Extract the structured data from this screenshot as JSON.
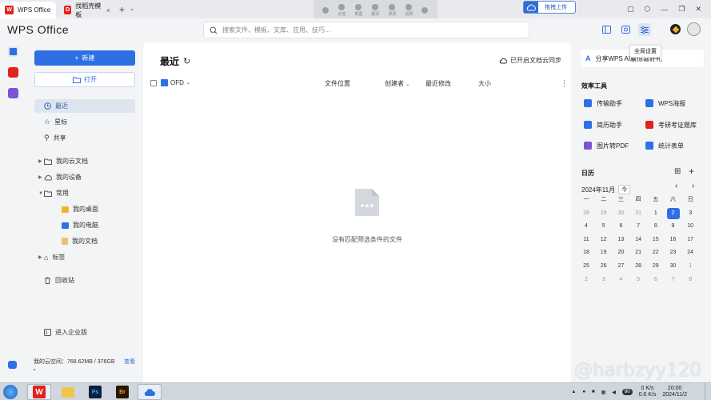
{
  "tabs": [
    {
      "label": "WPS Office",
      "icon": "wps-logo-icon",
      "color": "#e2231a",
      "active": true
    },
    {
      "label": "找稻壳模板",
      "icon": "docer-logo-icon",
      "color": "#e2231a",
      "active": false
    }
  ],
  "mini_tools": [
    "云签",
    "截图",
    "翻译",
    "录屏",
    "投屏",
    "隐私"
  ],
  "cloud_upload_label": "拖拽上传",
  "brand": "WPS Office",
  "search": {
    "placeholder": "搜索文件、模板、文库、应用、技巧..."
  },
  "tooltip": "全局设置",
  "nav": {
    "new_label": "新建",
    "open_label": "打开",
    "items": [
      {
        "label": "最近",
        "icon": "clock-icon",
        "active": true
      },
      {
        "label": "星标",
        "icon": "star-icon"
      },
      {
        "label": "共享",
        "icon": "share-icon"
      },
      {
        "label": "我的云文档",
        "icon": "folder-icon"
      },
      {
        "label": "我的设备",
        "icon": "cloud-device-icon"
      },
      {
        "label": "常用",
        "icon": "folder-icon"
      },
      {
        "label": "我的桌面",
        "icon": "desktop-folder-icon"
      },
      {
        "label": "我的电脑",
        "icon": "computer-icon"
      },
      {
        "label": "我的文档",
        "icon": "documents-icon"
      },
      {
        "label": "标签",
        "icon": "tag-icon"
      },
      {
        "label": "回收站",
        "icon": "trash-icon"
      }
    ],
    "enterprise_label": "进入企业版",
    "storage_text": "我的云空间：768.62MB / 376GB",
    "storage_link": "查看"
  },
  "main": {
    "title": "最近",
    "sync_label": "已开启文档云同步",
    "filter_label": "OFD",
    "columns": [
      "文件位置",
      "创建者",
      "最近修改",
      "大小"
    ],
    "empty_text": "没有匹配筛选条件的文件"
  },
  "right": {
    "share_label": "分享WPS AI赢惊喜好礼",
    "tools_title": "效率工具",
    "tools": [
      {
        "label": "传输助手",
        "color": "#2f6fe4"
      },
      {
        "label": "WPS海报",
        "color": "#2f6fe4"
      },
      {
        "label": "简历助手",
        "color": "#2f6fe4"
      },
      {
        "label": "考研考证题库",
        "color": "#e2231a"
      },
      {
        "label": "图片转PDF",
        "color": "#7b55d6"
      },
      {
        "label": "统计表单",
        "color": "#2f6fe4"
      }
    ],
    "calendar_title": "日历",
    "calendar_month": "2024年11月",
    "today_label": "今",
    "weekdays": [
      "一",
      "二",
      "三",
      "四",
      "五",
      "六",
      "日"
    ],
    "days": [
      [
        "28",
        "29",
        "30",
        "31",
        "1",
        "2",
        "3"
      ],
      [
        "4",
        "5",
        "6",
        "7",
        "8",
        "9",
        "10"
      ],
      [
        "11",
        "12",
        "13",
        "14",
        "15",
        "16",
        "17"
      ],
      [
        "18",
        "19",
        "20",
        "21",
        "22",
        "23",
        "24"
      ],
      [
        "25",
        "26",
        "27",
        "28",
        "29",
        "30",
        "1"
      ],
      [
        "2",
        "3",
        "4",
        "5",
        "6",
        "7",
        "8"
      ]
    ],
    "today": "2"
  },
  "taskbar": {
    "time": "20:00",
    "date": "2024/11/2",
    "battery": "80",
    "net_up": "0 K/s",
    "net_down": "0.6 K/s"
  },
  "watermark": "@harbzyy120"
}
